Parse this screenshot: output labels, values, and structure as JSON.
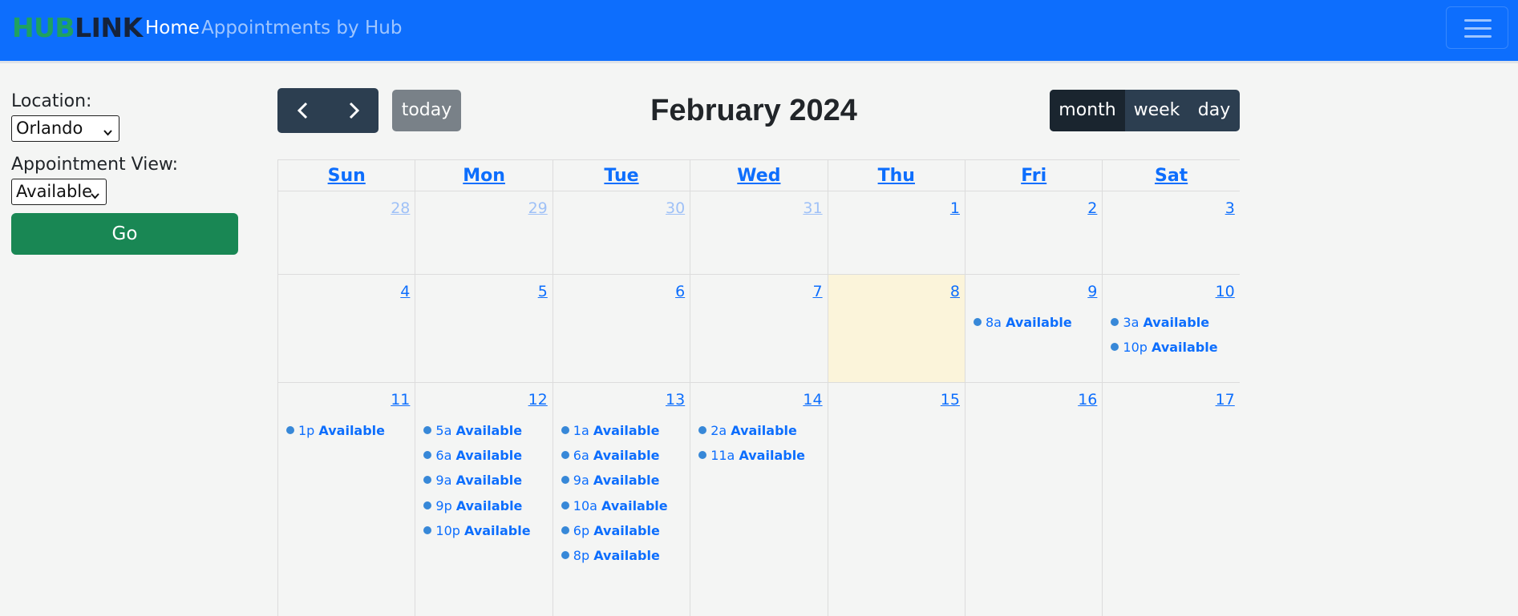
{
  "navbar": {
    "brand_part1": "HUB",
    "brand_part2": "LINK",
    "links": [
      "Home",
      "Appointments by Hub"
    ],
    "menu_icon": "hamburger-icon"
  },
  "sidebar": {
    "location_label": "Location:",
    "location_value": "Orlando",
    "view_label": "Appointment View:",
    "view_value": "Available",
    "go_label": "Go"
  },
  "toolbar": {
    "prev_icon": "chevron-left-icon",
    "next_icon": "chevron-right-icon",
    "today_label": "today",
    "title": "February 2024",
    "views": [
      "month",
      "week",
      "day"
    ],
    "active_view": "month"
  },
  "calendar": {
    "day_headers": [
      "Sun",
      "Mon",
      "Tue",
      "Wed",
      "Thu",
      "Fri",
      "Sat"
    ],
    "weeks": [
      [
        {
          "num": "28",
          "other": true,
          "events": []
        },
        {
          "num": "29",
          "other": true,
          "events": []
        },
        {
          "num": "30",
          "other": true,
          "events": []
        },
        {
          "num": "31",
          "other": true,
          "events": []
        },
        {
          "num": "1",
          "events": []
        },
        {
          "num": "2",
          "events": []
        },
        {
          "num": "3",
          "events": []
        }
      ],
      [
        {
          "num": "4",
          "events": []
        },
        {
          "num": "5",
          "events": []
        },
        {
          "num": "6",
          "events": []
        },
        {
          "num": "7",
          "events": []
        },
        {
          "num": "8",
          "today": true,
          "events": []
        },
        {
          "num": "9",
          "events": [
            {
              "time": "8a",
              "title": "Available"
            }
          ]
        },
        {
          "num": "10",
          "events": [
            {
              "time": "3a",
              "title": "Available"
            },
            {
              "time": "10p",
              "title": "Available"
            }
          ]
        }
      ],
      [
        {
          "num": "11",
          "events": [
            {
              "time": "1p",
              "title": "Available"
            }
          ]
        },
        {
          "num": "12",
          "events": [
            {
              "time": "5a",
              "title": "Available"
            },
            {
              "time": "6a",
              "title": "Available"
            },
            {
              "time": "9a",
              "title": "Available"
            },
            {
              "time": "9p",
              "title": "Available"
            },
            {
              "time": "10p",
              "title": "Available"
            }
          ]
        },
        {
          "num": "13",
          "events": [
            {
              "time": "1a",
              "title": "Available"
            },
            {
              "time": "6a",
              "title": "Available"
            },
            {
              "time": "9a",
              "title": "Available"
            },
            {
              "time": "10a",
              "title": "Available"
            },
            {
              "time": "6p",
              "title": "Available"
            },
            {
              "time": "8p",
              "title": "Available"
            }
          ]
        },
        {
          "num": "14",
          "events": [
            {
              "time": "2a",
              "title": "Available"
            },
            {
              "time": "11a",
              "title": "Available"
            }
          ]
        },
        {
          "num": "15",
          "events": []
        },
        {
          "num": "16",
          "events": []
        },
        {
          "num": "17",
          "events": []
        }
      ]
    ],
    "colors": {
      "link": "#0d6efd",
      "event_dot": "#3788d8",
      "today_bg": "#fbf4da"
    }
  }
}
